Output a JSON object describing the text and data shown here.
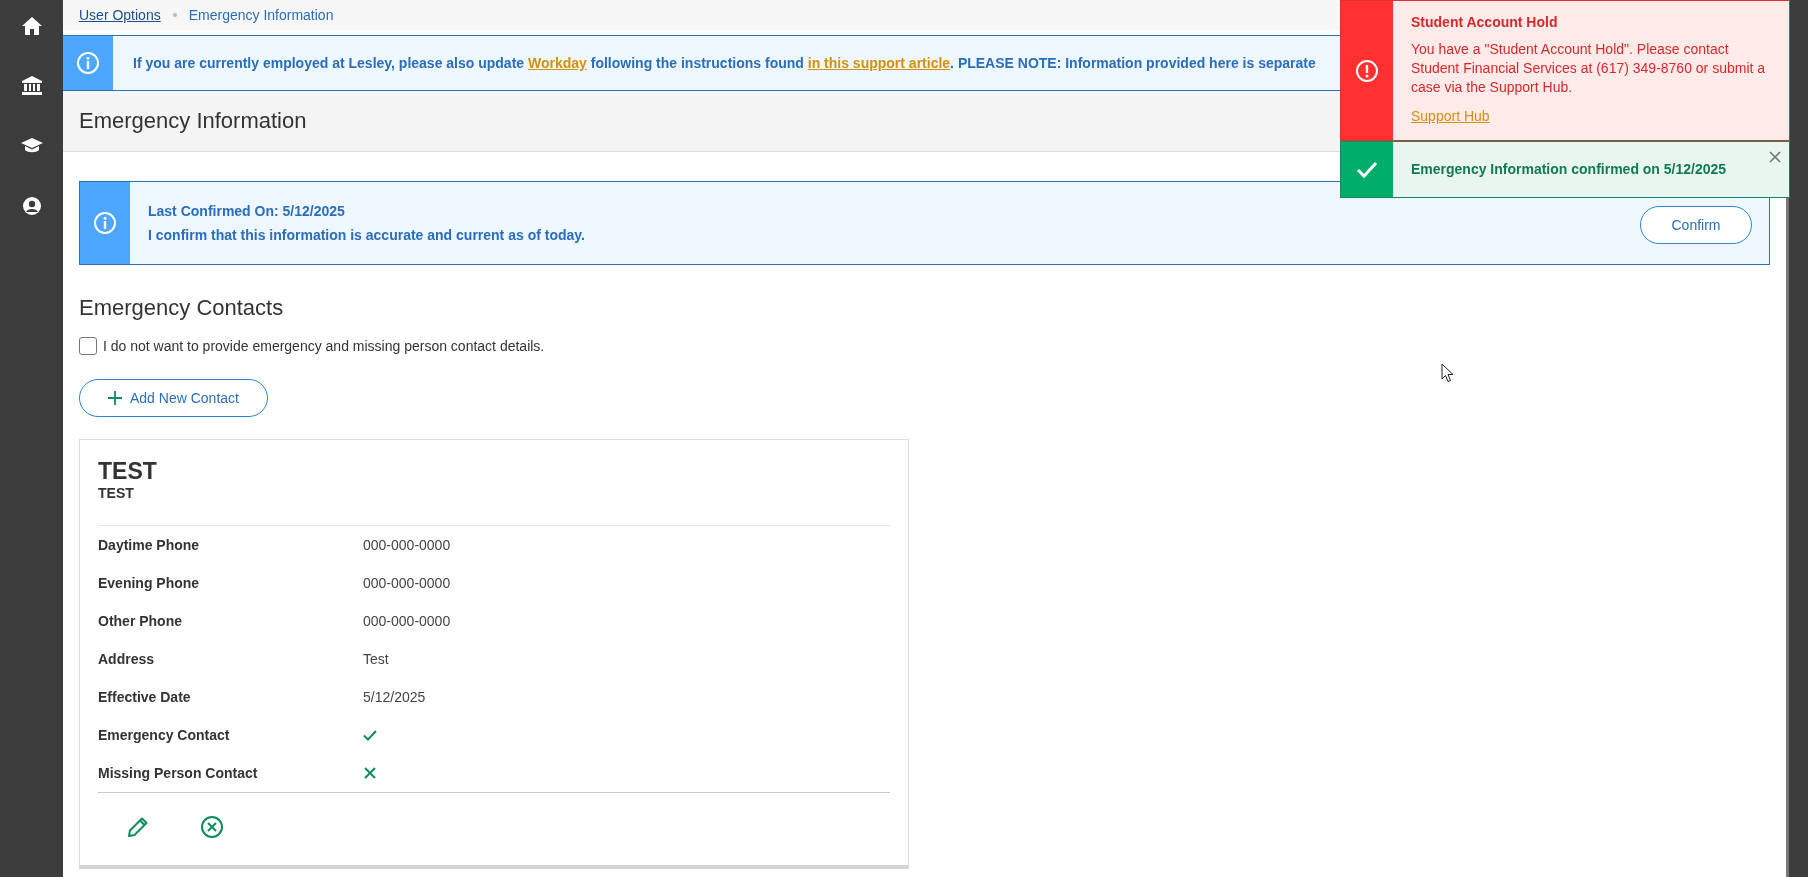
{
  "breadcrumb": [
    {
      "kind": "link",
      "label": "User Options"
    },
    {
      "kind": "current",
      "label": "Emergency Information"
    }
  ],
  "notice": {
    "parts": [
      {
        "kind": "text",
        "text": "If you are currently employed at Lesley, please also update "
      },
      {
        "kind": "link",
        "text": "Workday"
      },
      {
        "kind": "text",
        "text": " following the instructions found "
      },
      {
        "kind": "link",
        "text": "in this support article"
      },
      {
        "kind": "text",
        "text": ". PLEASE NOTE: Information provided here is separate"
      }
    ]
  },
  "page_title": "Emergency Information",
  "confirmation": {
    "title": "Last Confirmed On: 5/12/2025",
    "text": "I confirm that this information is accurate and current as of today.",
    "button": "Confirm"
  },
  "contacts": {
    "title": "Emergency Contacts",
    "opt_out": {
      "label": "I do not want to provide emergency and missing person contact details.",
      "checked": false
    },
    "add_button": "Add New Contact",
    "cards": [
      {
        "name": "TEST",
        "subtitle": "TEST",
        "fields": [
          {
            "label": "Daytime Phone",
            "kind": "text",
            "value": "000-000-0000"
          },
          {
            "label": "Evening Phone",
            "kind": "text",
            "value": "000-000-0000"
          },
          {
            "label": "Other Phone",
            "kind": "text",
            "value": "000-000-0000"
          },
          {
            "label": "Address",
            "kind": "text",
            "value": "Test"
          },
          {
            "label": "Effective Date",
            "kind": "text",
            "value": "5/12/2025"
          },
          {
            "label": "Emergency Contact",
            "kind": "flag",
            "on": true
          },
          {
            "label": "Missing Person Contact",
            "kind": "flag",
            "on": false
          }
        ]
      }
    ]
  },
  "toasts": [
    {
      "kind": "error",
      "title": "Student Account Hold",
      "message": "You have a \"Student Account Hold\". Please contact Student Financial Services at (617) 349-8760 or submit a case via the Support Hub.",
      "link": "Support Hub"
    },
    {
      "kind": "success",
      "message": "Emergency Information confirmed on 5/12/2025"
    }
  ]
}
